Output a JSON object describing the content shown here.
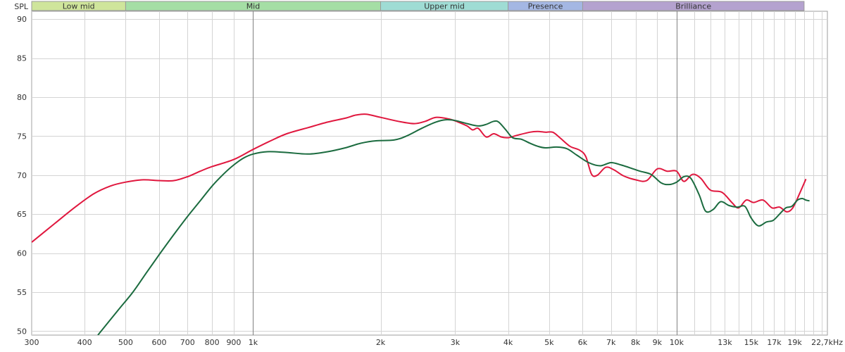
{
  "chart_data": {
    "type": "line",
    "ylabel": "SPL",
    "x_unit_label": "22,7kHz",
    "x_scale": "log",
    "xlim": [
      300,
      22700
    ],
    "ylim": [
      49.5,
      91
    ],
    "grid": true,
    "x_ticks": [
      {
        "v": 300,
        "label": "300",
        "major": false
      },
      {
        "v": 400,
        "label": "400",
        "major": false
      },
      {
        "v": 500,
        "label": "500",
        "major": false
      },
      {
        "v": 600,
        "label": "600",
        "major": false
      },
      {
        "v": 700,
        "label": "700",
        "major": false
      },
      {
        "v": 800,
        "label": "800",
        "major": false
      },
      {
        "v": 900,
        "label": "900",
        "major": false
      },
      {
        "v": 1000,
        "label": "1k",
        "major": true
      },
      {
        "v": 2000,
        "label": "2k",
        "major": false
      },
      {
        "v": 3000,
        "label": "3k",
        "major": false
      },
      {
        "v": 4000,
        "label": "4k",
        "major": false
      },
      {
        "v": 5000,
        "label": "5k",
        "major": false
      },
      {
        "v": 6000,
        "label": "6k",
        "major": false
      },
      {
        "v": 7000,
        "label": "7k",
        "major": false
      },
      {
        "v": 8000,
        "label": "8k",
        "major": false
      },
      {
        "v": 9000,
        "label": "9k",
        "major": false
      },
      {
        "v": 10000,
        "label": "10k",
        "major": true
      },
      {
        "v": 11000,
        "label": "",
        "major": false
      },
      {
        "v": 12000,
        "label": "",
        "major": false
      },
      {
        "v": 13000,
        "label": "13k",
        "major": false
      },
      {
        "v": 14000,
        "label": "",
        "major": false
      },
      {
        "v": 15000,
        "label": "15k",
        "major": false
      },
      {
        "v": 16000,
        "label": "",
        "major": false
      },
      {
        "v": 17000,
        "label": "17k",
        "major": false
      },
      {
        "v": 18000,
        "label": "",
        "major": false
      },
      {
        "v": 19000,
        "label": "19k",
        "major": false
      },
      {
        "v": 20000,
        "label": "",
        "major": false
      },
      {
        "v": 21000,
        "label": "",
        "major": false
      },
      {
        "v": 22000,
        "label": "",
        "major": false
      }
    ],
    "y_ticks": [
      50,
      55,
      60,
      65,
      70,
      75,
      80,
      85,
      90
    ],
    "bands": [
      {
        "label": "Low mid",
        "from": 300,
        "to": 500,
        "color": "#cfe59b"
      },
      {
        "label": "Mid",
        "from": 500,
        "to": 2000,
        "color": "#a5dea5"
      },
      {
        "label": "Upper mid",
        "from": 2000,
        "to": 4000,
        "color": "#9fdcd4"
      },
      {
        "label": "Presence",
        "from": 4000,
        "to": 6000,
        "color": "#a4b7e3"
      },
      {
        "label": "Brilliance",
        "from": 6000,
        "to": 20000,
        "color": "#b4a2cf"
      }
    ],
    "series": [
      {
        "color": "#e0173e",
        "points": [
          [
            300,
            61.4
          ],
          [
            340,
            63.8
          ],
          [
            380,
            65.9
          ],
          [
            420,
            67.6
          ],
          [
            460,
            68.6
          ],
          [
            500,
            69.1
          ],
          [
            550,
            69.4
          ],
          [
            600,
            69.3
          ],
          [
            650,
            69.3
          ],
          [
            700,
            69.8
          ],
          [
            750,
            70.5
          ],
          [
            800,
            71.1
          ],
          [
            900,
            72.0
          ],
          [
            1000,
            73.3
          ],
          [
            1100,
            74.4
          ],
          [
            1200,
            75.3
          ],
          [
            1350,
            76.1
          ],
          [
            1500,
            76.8
          ],
          [
            1650,
            77.3
          ],
          [
            1750,
            77.7
          ],
          [
            1850,
            77.8
          ],
          [
            2000,
            77.4
          ],
          [
            2200,
            76.9
          ],
          [
            2400,
            76.6
          ],
          [
            2550,
            76.9
          ],
          [
            2700,
            77.4
          ],
          [
            2900,
            77.2
          ],
          [
            3050,
            76.8
          ],
          [
            3200,
            76.3
          ],
          [
            3300,
            75.8
          ],
          [
            3400,
            76.0
          ],
          [
            3550,
            74.9
          ],
          [
            3700,
            75.3
          ],
          [
            3850,
            74.9
          ],
          [
            4000,
            74.8
          ],
          [
            4200,
            75.1
          ],
          [
            4500,
            75.5
          ],
          [
            4700,
            75.6
          ],
          [
            4900,
            75.5
          ],
          [
            5100,
            75.5
          ],
          [
            5300,
            74.8
          ],
          [
            5600,
            73.7
          ],
          [
            5900,
            73.2
          ],
          [
            6100,
            72.4
          ],
          [
            6300,
            70.1
          ],
          [
            6500,
            70.0
          ],
          [
            6800,
            71.0
          ],
          [
            7100,
            70.7
          ],
          [
            7500,
            69.9
          ],
          [
            8000,
            69.4
          ],
          [
            8500,
            69.3
          ],
          [
            9000,
            70.8
          ],
          [
            9500,
            70.5
          ],
          [
            10000,
            70.5
          ],
          [
            10400,
            69.2
          ],
          [
            10900,
            70.1
          ],
          [
            11400,
            69.6
          ],
          [
            12000,
            68.1
          ],
          [
            12800,
            67.8
          ],
          [
            13500,
            66.5
          ],
          [
            14000,
            65.8
          ],
          [
            14600,
            66.8
          ],
          [
            15200,
            66.5
          ],
          [
            16000,
            66.8
          ],
          [
            16800,
            65.8
          ],
          [
            17500,
            65.9
          ],
          [
            18200,
            65.3
          ],
          [
            18800,
            65.8
          ],
          [
            19500,
            67.6
          ],
          [
            20200,
            69.5
          ]
        ]
      },
      {
        "color": "#1b6b3f",
        "points": [
          [
            430,
            49.5
          ],
          [
            480,
            52.7
          ],
          [
            520,
            55.0
          ],
          [
            560,
            57.5
          ],
          [
            600,
            59.8
          ],
          [
            650,
            62.4
          ],
          [
            700,
            64.7
          ],
          [
            750,
            66.7
          ],
          [
            800,
            68.6
          ],
          [
            850,
            70.1
          ],
          [
            900,
            71.3
          ],
          [
            950,
            72.2
          ],
          [
            1000,
            72.7
          ],
          [
            1080,
            73.0
          ],
          [
            1200,
            72.9
          ],
          [
            1350,
            72.7
          ],
          [
            1500,
            73.0
          ],
          [
            1650,
            73.5
          ],
          [
            1800,
            74.1
          ],
          [
            1950,
            74.4
          ],
          [
            2150,
            74.5
          ],
          [
            2300,
            75.0
          ],
          [
            2500,
            76.0
          ],
          [
            2700,
            76.8
          ],
          [
            2850,
            77.1
          ],
          [
            3000,
            77.0
          ],
          [
            3200,
            76.6
          ],
          [
            3400,
            76.3
          ],
          [
            3550,
            76.5
          ],
          [
            3700,
            76.9
          ],
          [
            3800,
            76.8
          ],
          [
            3950,
            75.8
          ],
          [
            4100,
            74.8
          ],
          [
            4300,
            74.6
          ],
          [
            4500,
            74.1
          ],
          [
            4700,
            73.7
          ],
          [
            4900,
            73.5
          ],
          [
            5200,
            73.6
          ],
          [
            5500,
            73.4
          ],
          [
            5800,
            72.6
          ],
          [
            6200,
            71.6
          ],
          [
            6600,
            71.2
          ],
          [
            7000,
            71.6
          ],
          [
            7400,
            71.3
          ],
          [
            7800,
            70.9
          ],
          [
            8200,
            70.5
          ],
          [
            8700,
            70.1
          ],
          [
            9200,
            69.0
          ],
          [
            9600,
            68.8
          ],
          [
            10000,
            69.1
          ],
          [
            10400,
            69.8
          ],
          [
            10800,
            69.6
          ],
          [
            11300,
            67.5
          ],
          [
            11700,
            65.4
          ],
          [
            12200,
            65.6
          ],
          [
            12700,
            66.6
          ],
          [
            13300,
            66.1
          ],
          [
            13900,
            65.9
          ],
          [
            14500,
            66.0
          ],
          [
            15000,
            64.5
          ],
          [
            15600,
            63.5
          ],
          [
            16300,
            64.0
          ],
          [
            16900,
            64.2
          ],
          [
            17500,
            65.0
          ],
          [
            18100,
            65.8
          ],
          [
            18700,
            66.0
          ],
          [
            19300,
            66.8
          ],
          [
            19800,
            67.0
          ],
          [
            20200,
            66.8
          ],
          [
            20600,
            66.7
          ]
        ]
      }
    ]
  }
}
